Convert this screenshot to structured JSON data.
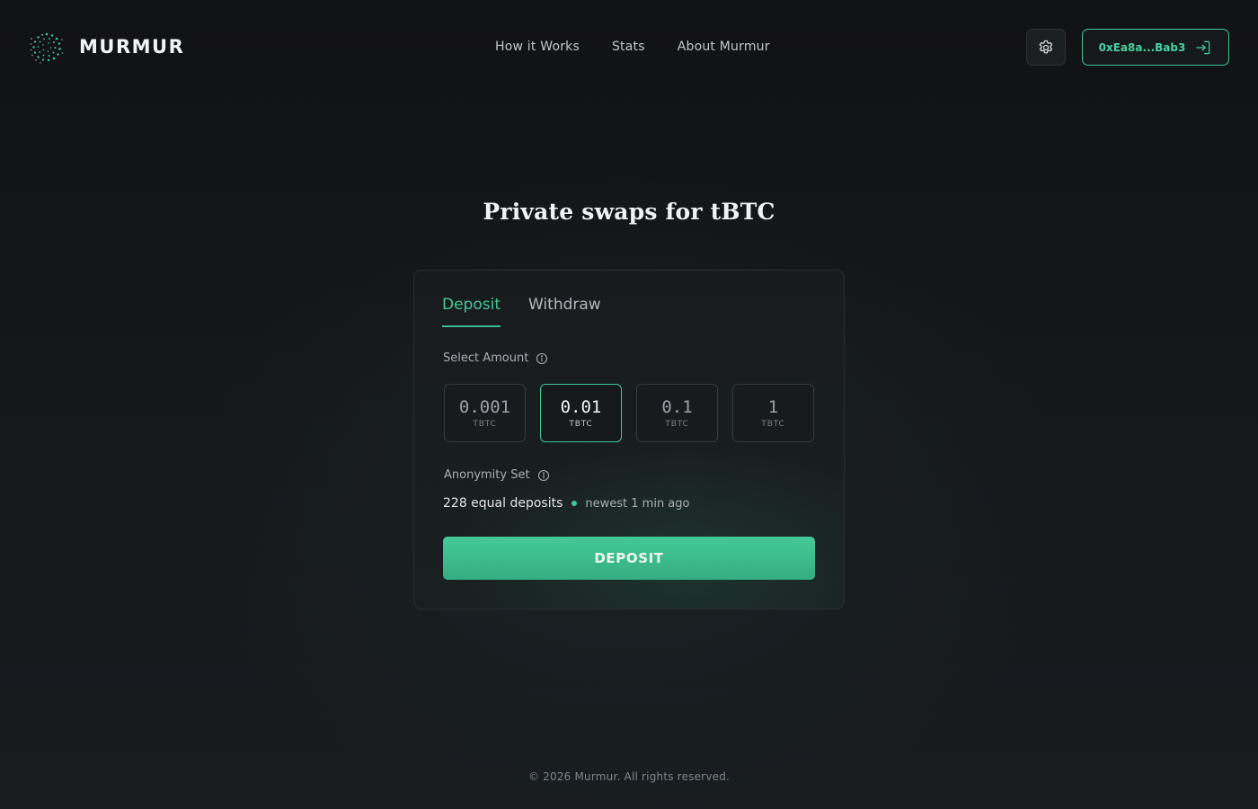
{
  "brand": {
    "name": "MURMUR"
  },
  "nav": {
    "items": [
      {
        "label": "How it Works"
      },
      {
        "label": "Stats"
      },
      {
        "label": "About Murmur"
      }
    ]
  },
  "header": {
    "settings_icon": "gear-icon",
    "wallet": {
      "address": "0xEa8a...Bab3",
      "icon": "sign-in-icon"
    }
  },
  "hero": {
    "title": "Private swaps for tBTC"
  },
  "card": {
    "tabs": [
      {
        "label": "Deposit",
        "active": true
      },
      {
        "label": "Withdraw",
        "active": false
      }
    ],
    "select_amount": {
      "label": "Select Amount",
      "icon": "info-icon"
    },
    "amounts": [
      {
        "value": "0.001",
        "unit": "TBTC",
        "selected": false
      },
      {
        "value": "0.01",
        "unit": "TBTC",
        "selected": true
      },
      {
        "value": "0.1",
        "unit": "TBTC",
        "selected": false
      },
      {
        "value": "1",
        "unit": "TBTC",
        "selected": false
      }
    ],
    "anonymity": {
      "label": "Anonymity Set",
      "icon": "info-icon",
      "count_text": "228 equal deposits",
      "newest_text": "newest 1 min ago"
    },
    "deposit_button": "DEPOSIT"
  },
  "footer": {
    "text": "© 2026 Murmur. All rights reserved."
  },
  "colors": {
    "accent": "#3ec896",
    "background": "#131517",
    "card": "#181b1e",
    "text": "#f1f2f4"
  }
}
